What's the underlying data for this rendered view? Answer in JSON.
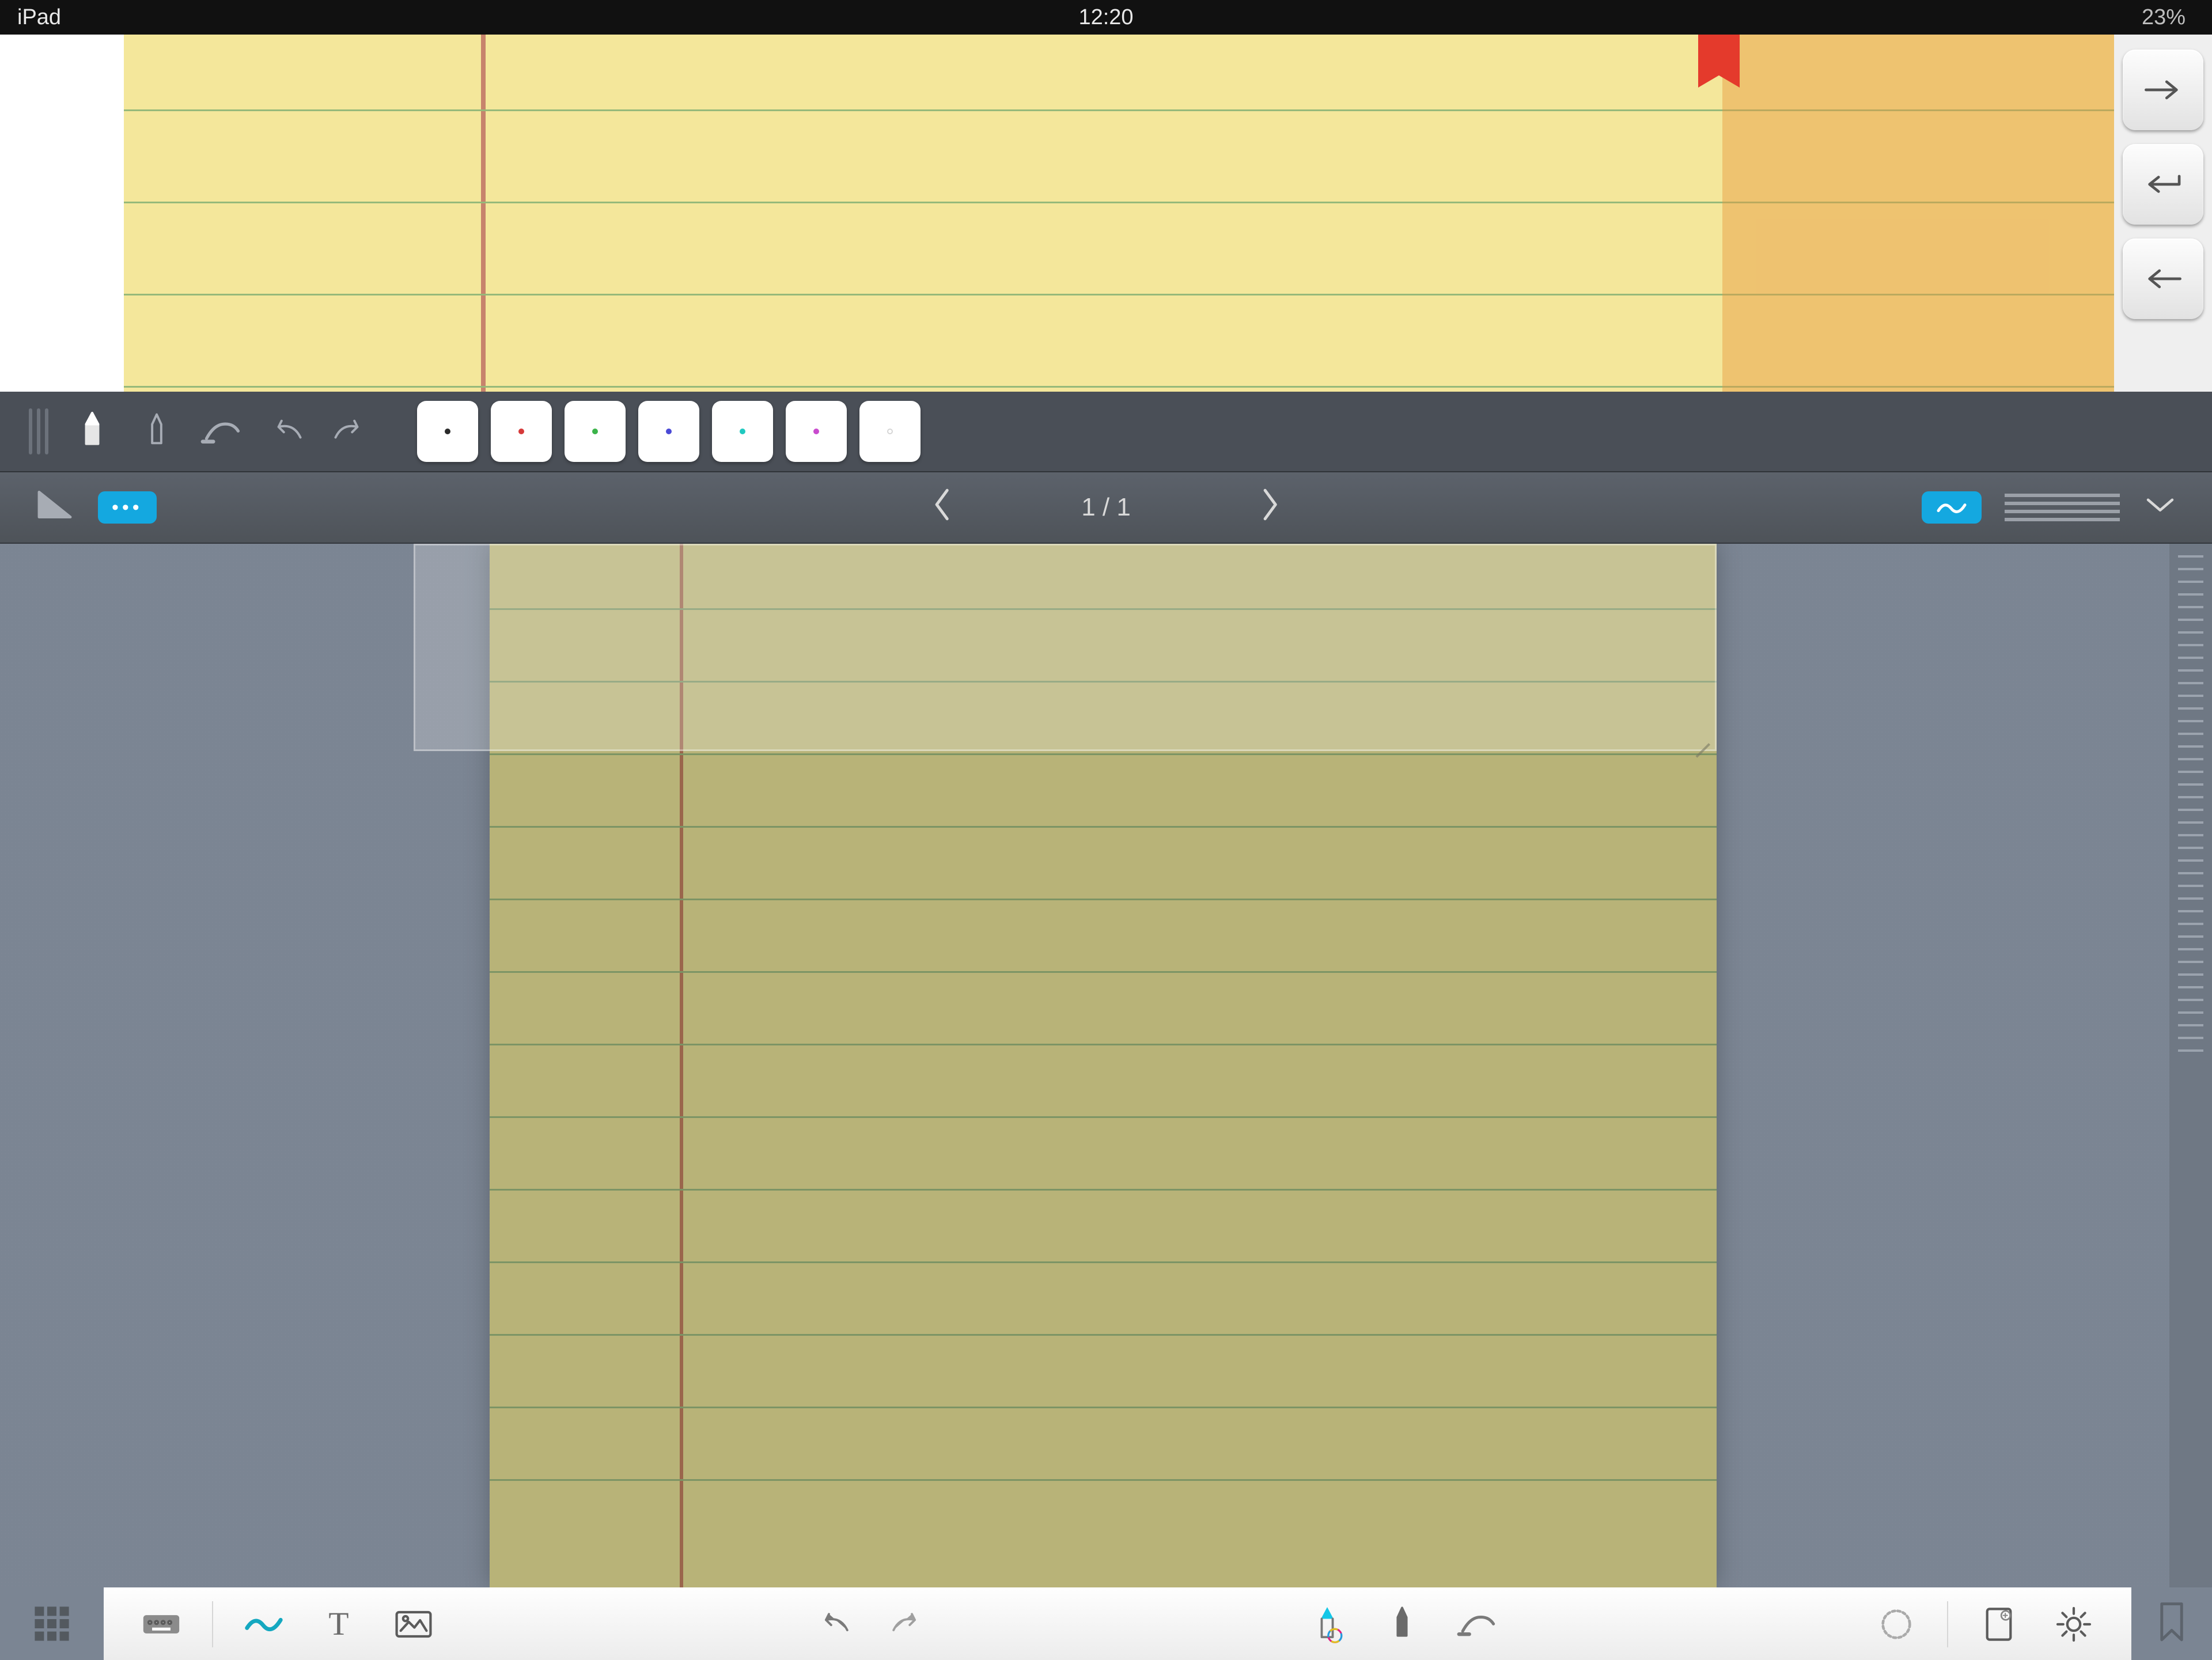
{
  "status_bar": {
    "device": "iPad",
    "time": "12:20",
    "battery_pct": "23%"
  },
  "zoom_panel": {
    "buttons": {
      "tab_forward": "tab-forward",
      "return": "return",
      "back": "back"
    }
  },
  "dark_strip": {
    "tools": [
      "pen",
      "highlighter",
      "eraser",
      "undo",
      "redo"
    ],
    "swatches": [
      {
        "color": "#2b2b2b"
      },
      {
        "color": "#d63a3a"
      },
      {
        "color": "#3bb34a"
      },
      {
        "color": "#4a49d6"
      },
      {
        "color": "#20c9c0"
      },
      {
        "color": "#c94bce"
      },
      {
        "color": "#ffffff"
      }
    ]
  },
  "nav_bar": {
    "page_indicator": "1 / 1"
  },
  "bottom_bar": {
    "tools": [
      "keyboard",
      "draw",
      "text",
      "image",
      "undo",
      "redo",
      "pen-style",
      "highlighter-style",
      "eraser-style",
      "shape",
      "page-settings",
      "settings"
    ]
  }
}
